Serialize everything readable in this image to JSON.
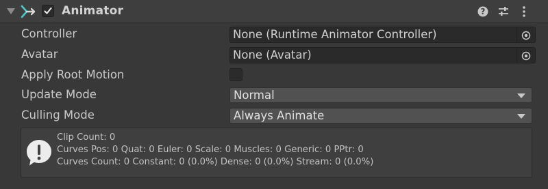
{
  "component": {
    "title": "Animator",
    "enabled": true,
    "icons": {
      "foldout": "foldout-arrow-icon",
      "component": "animator-component-icon",
      "help": "help-icon",
      "presets": "presets-icon",
      "menu": "context-menu-icon"
    }
  },
  "fields": {
    "controller": {
      "label": "Controller",
      "value": "None (Runtime Animator Controller)"
    },
    "avatar": {
      "label": "Avatar",
      "value": "None (Avatar)"
    },
    "apply_root_motion": {
      "label": "Apply Root Motion",
      "checked": false
    },
    "update_mode": {
      "label": "Update Mode",
      "value": "Normal"
    },
    "culling_mode": {
      "label": "Culling Mode",
      "value": "Always Animate"
    }
  },
  "info": {
    "line1": "Clip Count: 0",
    "line2": "Curves Pos: 0 Quat: 0 Euler: 0 Scale: 0 Muscles: 0 Generic: 0 PPtr: 0",
    "line3": "Curves Count: 0 Constant: 0 (0.0%) Dense: 0 (0.0%) Stream: 0 (0.0%)"
  },
  "colors": {
    "background": "#383838",
    "header": "#3e3e3e",
    "field": "#2a2a2a",
    "dropdown": "#515151",
    "accent_icon": "#4ec9c9"
  }
}
